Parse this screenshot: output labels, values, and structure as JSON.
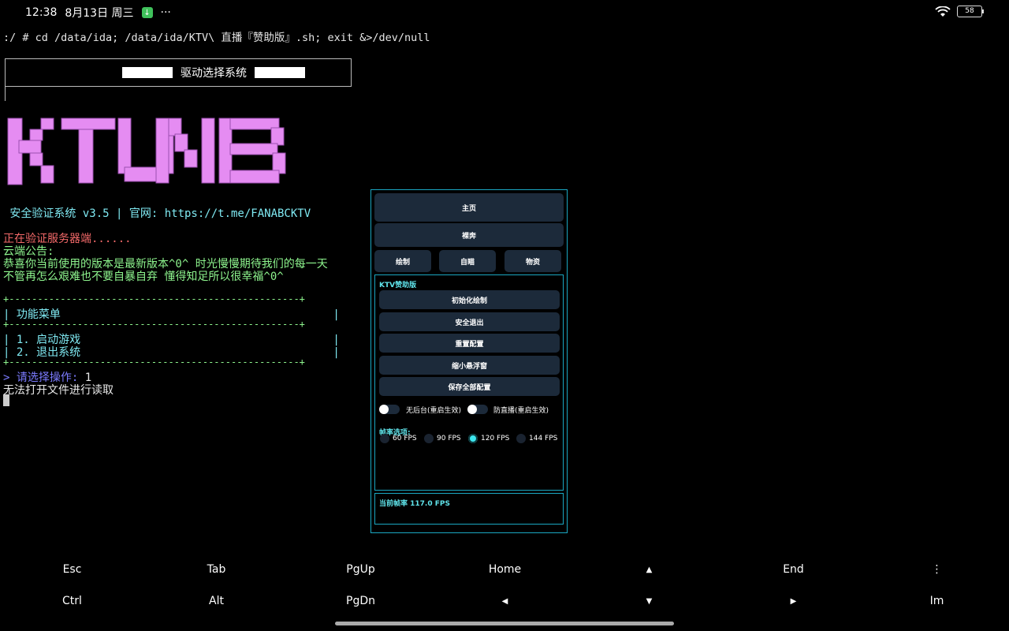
{
  "status_bar": {
    "time": "12:38",
    "date": "8月13日 周三",
    "more": "···",
    "battery": "58"
  },
  "terminal": {
    "command": ":/ # cd /data/ida; /data/ida/KTV\\ 直播『赞助版』.sh; exit &>/dev/null",
    "box_title": "驱动选择系统",
    "logo_text": "KTUNB",
    "version_line": " 安全验证系统 v3.5 | 官网: https://t.me/FANABCKTV",
    "verifying": "正在验证服务器端......",
    "announce_label": "云端公告:",
    "announce_1": "恭喜你当前使用的版本是最新版本^0^ 时光慢慢期待我们的每一天",
    "announce_2": "不管再怎么艰难也不要自暴自弃 懂得知足所以很幸福^0^",
    "sep": "+---------------------------------------------------+",
    "menu_title": "| 功能菜单                                         |",
    "menu_1": "| 1. 启动游戏                                      |",
    "menu_2": "| 2. 退出系统                                      |",
    "prompt": "> 请选择操作: ",
    "input": "1",
    "error": "无法打开文件进行读取"
  },
  "panel": {
    "tab_home": "主页",
    "tab_raw": "裸奔",
    "tab_draw": "绘制",
    "tab_aim": "自瞄",
    "tab_items": "物资",
    "section_title": "KTV赞助版",
    "btn_init": "初始化绘制",
    "btn_exit": "安全退出",
    "btn_reset": "重置配置",
    "btn_shrink": "缩小悬浮窗",
    "btn_save": "保存全部配置",
    "toggle_1": "无后台(重启生效)",
    "toggle_2": "防直播(重启生效)",
    "fps_title": "帧率选项:",
    "fps_options": [
      "60 FPS",
      "90 FPS",
      "120 FPS",
      "144 FPS"
    ],
    "fps_selected": "120 FPS",
    "current_fps": "当前帧率 117.0 FPS"
  },
  "extra_keys": {
    "row1": [
      "Esc",
      "Tab",
      "PgUp",
      "Home",
      "▲",
      "End",
      "⋮"
    ],
    "row2": [
      "Ctrl",
      "Alt",
      "PgDn",
      "◀",
      "▼",
      "▶",
      "Im"
    ]
  },
  "colors": {
    "logo": "#e58cf2",
    "accent": "#1aa7c2",
    "button_bg": "#1c2a3a"
  }
}
